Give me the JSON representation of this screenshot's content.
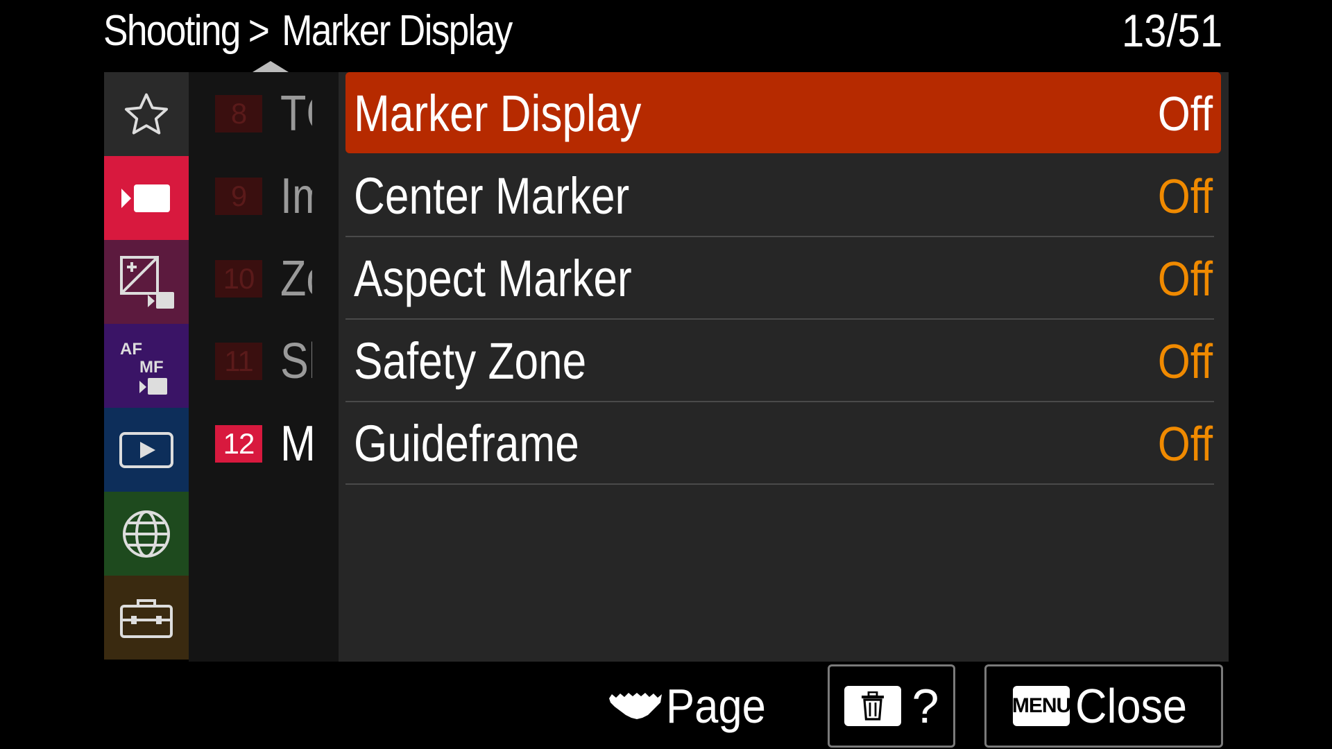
{
  "header": {
    "breadcrumb_parent": "Shooting",
    "breadcrumb_separator": ">",
    "breadcrumb_current": "Marker Display",
    "page_counter": "13/51"
  },
  "tabs": [
    {
      "icon": "star-icon",
      "color": "#2a2a2a",
      "selected": false
    },
    {
      "icon": "movie-camera-icon",
      "color": "#d8193e",
      "selected": true
    },
    {
      "icon": "exposure-movie-icon",
      "color": "#5c1a3e",
      "selected": false
    },
    {
      "icon": "af-mf-movie-icon",
      "color": "#3a1466",
      "selected": false
    },
    {
      "icon": "playback-icon",
      "color": "#0d2e5a",
      "selected": false
    },
    {
      "icon": "globe-icon",
      "color": "#1e4a1e",
      "selected": false
    },
    {
      "icon": "toolbox-icon",
      "color": "#3a2a10",
      "selected": false
    }
  ],
  "groups": [
    {
      "number": "8",
      "name": "TC"
    },
    {
      "number": "9",
      "name": "Im"
    },
    {
      "number": "10",
      "name": "Zo"
    },
    {
      "number": "11",
      "name": "Sh"
    },
    {
      "number": "12",
      "name": "Ma"
    }
  ],
  "items": [
    {
      "label": "Marker Display",
      "value": "Off"
    },
    {
      "label": "Center Marker",
      "value": "Off"
    },
    {
      "label": "Aspect Marker",
      "value": "Off"
    },
    {
      "label": "Safety Zone",
      "value": "Off"
    },
    {
      "label": "Guideframe",
      "value": "Off"
    }
  ],
  "footer": {
    "page_label": "Page",
    "help_label": "?",
    "menu_badge": "MENU",
    "close_label": "Close"
  }
}
